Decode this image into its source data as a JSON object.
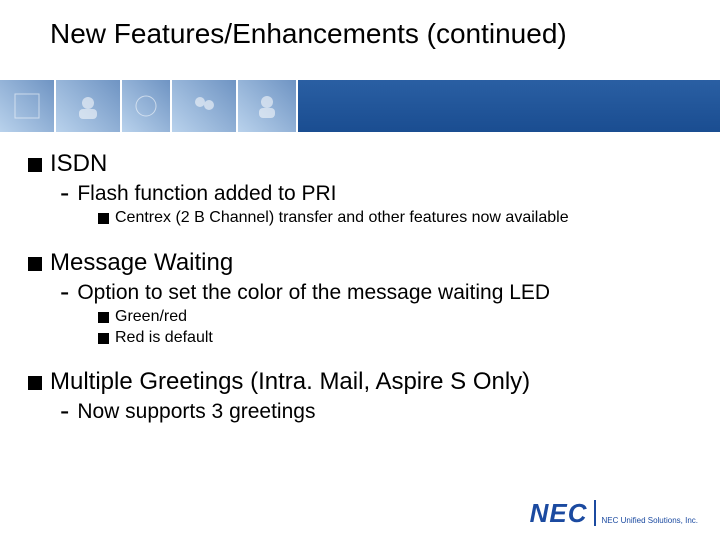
{
  "title": "New Features/Enhancements (continued)",
  "sections": [
    {
      "heading": "ISDN",
      "subs": [
        {
          "text": "Flash function added to PRI",
          "points": [
            "Centrex (2 B Channel) transfer and other features now available"
          ]
        }
      ]
    },
    {
      "heading": "Message Waiting",
      "subs": [
        {
          "text": "Option to set the color of the message waiting LED",
          "points": [
            "Green/red",
            "Red is default"
          ]
        }
      ]
    },
    {
      "heading": "Multiple Greetings (Intra. Mail, Aspire S Only)",
      "subs": [
        {
          "text": "Now supports 3 greetings",
          "points": []
        }
      ]
    }
  ],
  "logo": {
    "mark": "NEC",
    "tag": "NEC Unified Solutions, Inc."
  }
}
